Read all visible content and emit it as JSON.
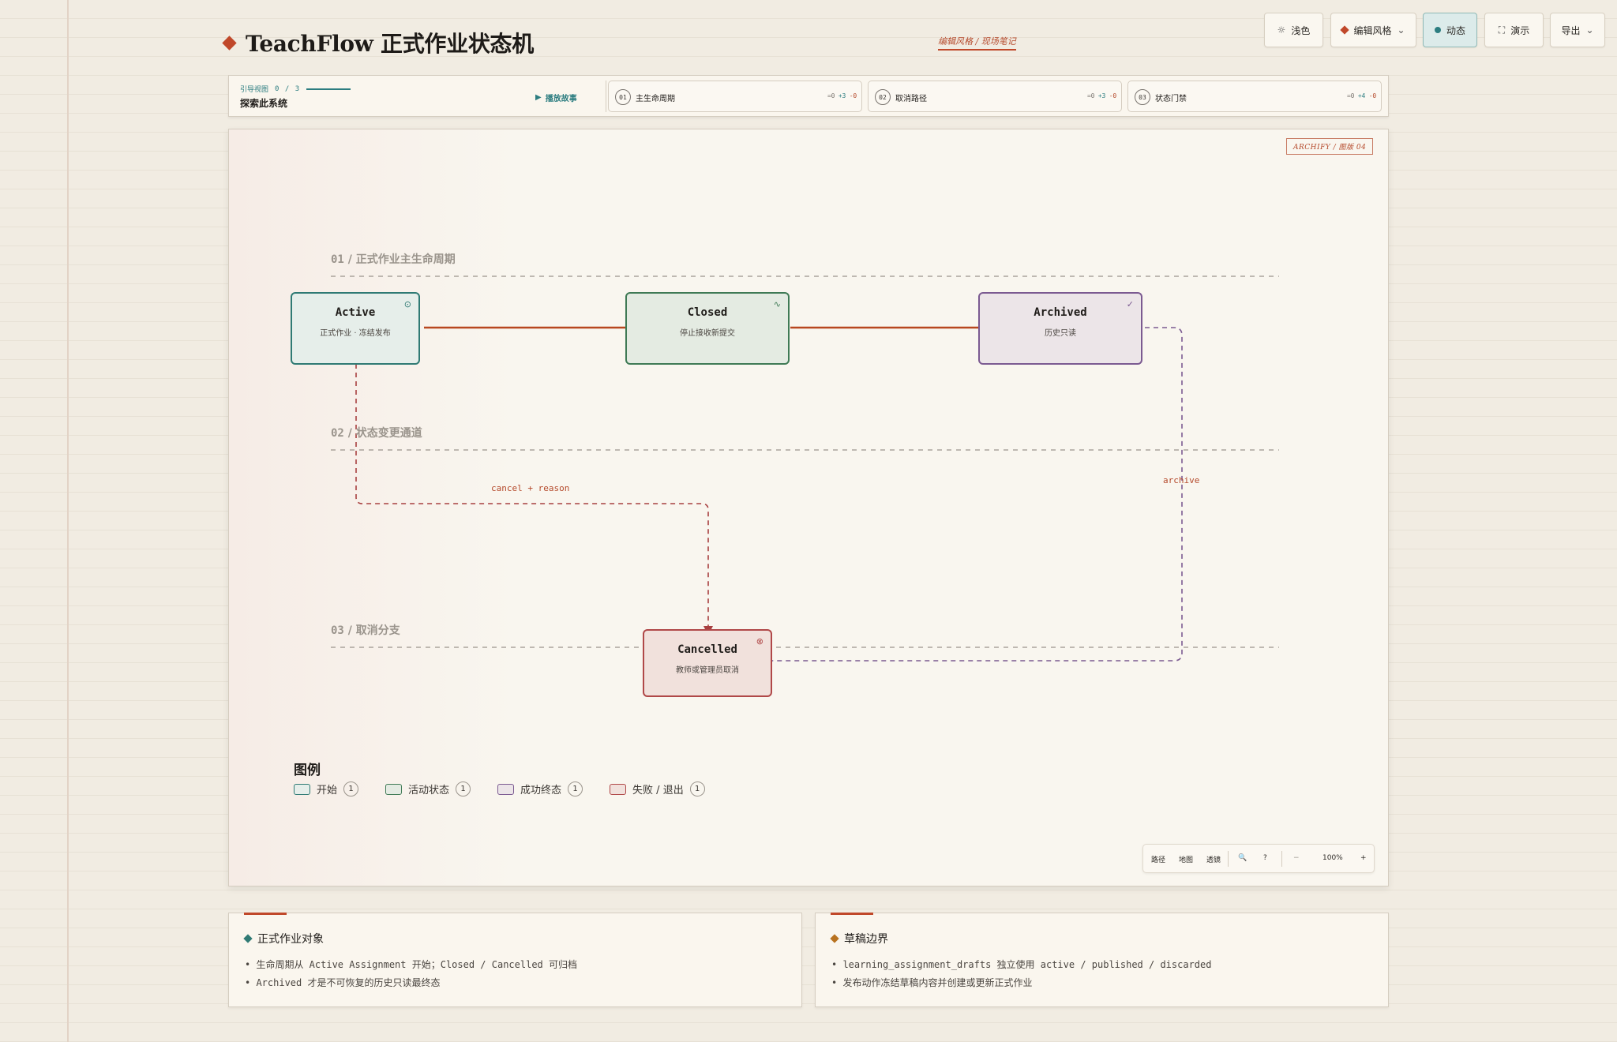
{
  "app_title": "TeachFlow 正式作业状态机",
  "style_tag": "编辑风格 / 现场笔记",
  "toolbar": {
    "theme_label": "浅色",
    "style_label": "编辑风格",
    "motion_label": "动态",
    "present_label": "演示",
    "export_label": "导出"
  },
  "story": {
    "guide_label": "引导视图",
    "guide_count": "0 / 3",
    "guide_title": "探索此系统",
    "play_label": "播放故事",
    "chapters": [
      {
        "num": "01",
        "name": "主生命周期",
        "zero": "=0",
        "plus": "+3",
        "minus": "-0"
      },
      {
        "num": "02",
        "name": "取消路径",
        "zero": "=0",
        "plus": "+3",
        "minus": "-0"
      },
      {
        "num": "03",
        "name": "状态门禁",
        "zero": "=0",
        "plus": "+4",
        "minus": "-0"
      }
    ]
  },
  "diagram": {
    "archify_tag": "ARCHIFY / 图版 04",
    "lanes": [
      {
        "num": "01",
        "label": "正式作业主生命周期"
      },
      {
        "num": "02",
        "label": "状态变更通道"
      },
      {
        "num": "03",
        "label": "取消分支"
      }
    ],
    "nodes": {
      "active": {
        "title": "Active",
        "subtitle": "正式作业 · 冻结发布"
      },
      "closed": {
        "title": "Closed",
        "subtitle": "停止接收新提交"
      },
      "archived": {
        "title": "Archived",
        "subtitle": "历史只读"
      },
      "cancelled": {
        "title": "Cancelled",
        "subtitle": "教师或管理员取消"
      }
    },
    "edge_labels": {
      "cancel": "cancel + reason",
      "archive": "archive"
    },
    "colors": {
      "start": "#2f7a74",
      "active": "#3f7a55",
      "success": "#7b5a91",
      "fail": "#b04848",
      "edge": "#c0482a"
    }
  },
  "legend": {
    "title": "图例",
    "items": [
      {
        "label": "开始",
        "count": "1"
      },
      {
        "label": "活动状态",
        "count": "1"
      },
      {
        "label": "成功终态",
        "count": "1"
      },
      {
        "label": "失败 / 退出",
        "count": "1"
      }
    ]
  },
  "zoom_bar": {
    "path": "路径",
    "map": "地图",
    "lens": "透镜",
    "search_icon": "🔍",
    "help_icon": "?",
    "minus": "−",
    "level": "100%",
    "plus": "+"
  },
  "cards": [
    {
      "title": "正式作业对象",
      "lines": [
        "生命周期从 Active Assignment 开始；Closed / Cancelled 可归档",
        "Archived 才是不可恢复的历史只读最终态"
      ]
    },
    {
      "title": "草稿边界",
      "lines": [
        "learning_assignment_drafts 独立使用 active / published / discarded",
        "发布动作冻结草稿内容并创建或更新正式作业"
      ]
    }
  ]
}
